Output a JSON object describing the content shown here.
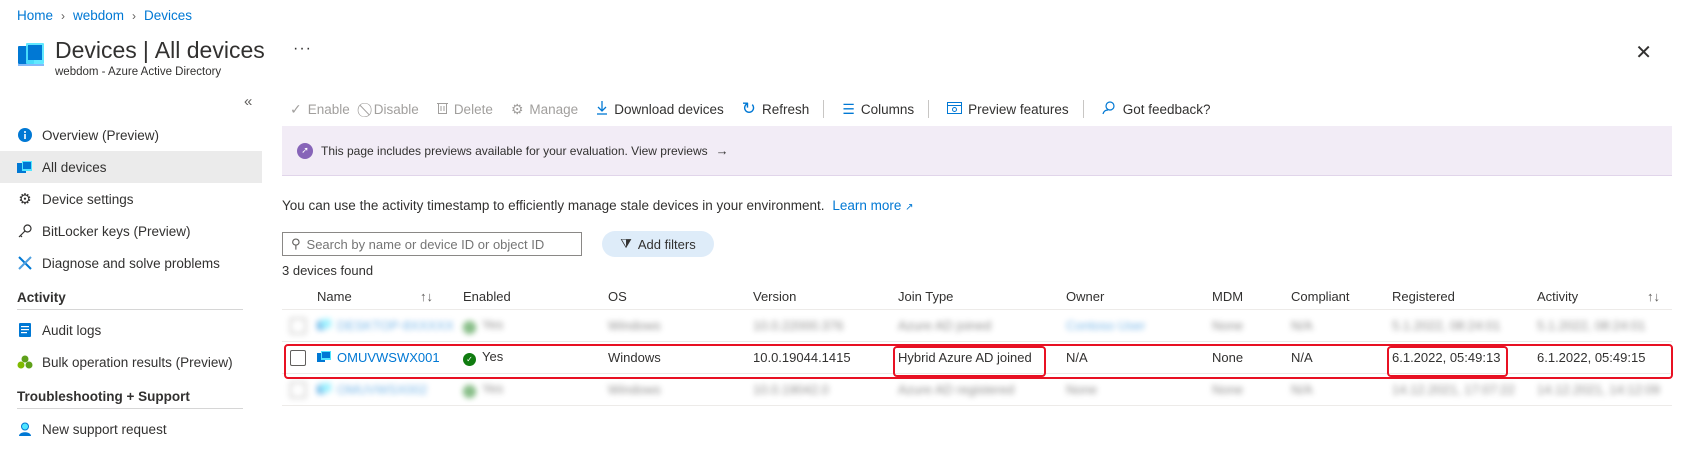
{
  "breadcrumb": {
    "home": "Home",
    "tenant": "webdom",
    "current": "Devices"
  },
  "header": {
    "title": "Devices",
    "subtitle_part": "All devices",
    "tenant_line": "webdom - Azure Active Directory",
    "more": "···",
    "close": "✕"
  },
  "sidebar": {
    "collapse": "«",
    "items": [
      {
        "label": "Overview (Preview)"
      },
      {
        "label": "All devices"
      },
      {
        "label": "Device settings"
      },
      {
        "label": "BitLocker keys (Preview)"
      },
      {
        "label": "Diagnose and solve problems"
      }
    ],
    "activity_header": "Activity",
    "activity_items": [
      {
        "label": "Audit logs"
      },
      {
        "label": "Bulk operation results (Preview)"
      }
    ],
    "support_header": "Troubleshooting + Support",
    "support_items": [
      {
        "label": "New support request"
      }
    ]
  },
  "toolbar": {
    "enable": "Enable",
    "disable": "Disable",
    "delete": "Delete",
    "manage": "Manage",
    "download": "Download devices",
    "refresh": "Refresh",
    "columns": "Columns",
    "preview": "Preview features",
    "feedback": "Got feedback?"
  },
  "banner": {
    "text": "This page includes previews available for your evaluation. View previews"
  },
  "info": {
    "text": "You can use the activity timestamp to efficiently manage stale devices in your environment.",
    "link": "Learn more"
  },
  "search": {
    "placeholder": "Search by name or device ID or object ID"
  },
  "filters": {
    "label": "Add filters"
  },
  "count": "3 devices found",
  "table": {
    "headers": [
      "Name",
      "Enabled",
      "OS",
      "Version",
      "Join Type",
      "Owner",
      "MDM",
      "Compliant",
      "Registered",
      "Activity"
    ],
    "rows": [
      {
        "name": "DESKTOP-8XXXXX",
        "enabled": "Yes",
        "os": "Windows",
        "version": "10.0.22000.376",
        "join": "Azure AD joined",
        "owner": "Contoso User",
        "mdm": "None",
        "compliant": "N/A",
        "registered": "5.1.2022, 08:24:01",
        "activity": "5.1.2022, 08:24:01"
      },
      {
        "name": "OMUVWSWX001",
        "enabled": "Yes",
        "os": "Windows",
        "version": "10.0.19044.1415",
        "join": "Hybrid Azure AD joined",
        "owner": "N/A",
        "mdm": "None",
        "compliant": "N/A",
        "registered": "6.1.2022, 05:49:13",
        "activity": "6.1.2022, 05:49:15"
      },
      {
        "name": "OMUVWSX002",
        "enabled": "Yes",
        "os": "Windows",
        "version": "10.0.19042.0",
        "join": "Azure AD registered",
        "owner": "None",
        "mdm": "None",
        "compliant": "N/A",
        "registered": "14.12.2021, 17:07:22",
        "activity": "14.12.2021, 14:12:09"
      }
    ]
  },
  "colors": {
    "accent": "#0078d4",
    "highlight": "#e81123",
    "banner_bg": "#f2ecf6"
  }
}
